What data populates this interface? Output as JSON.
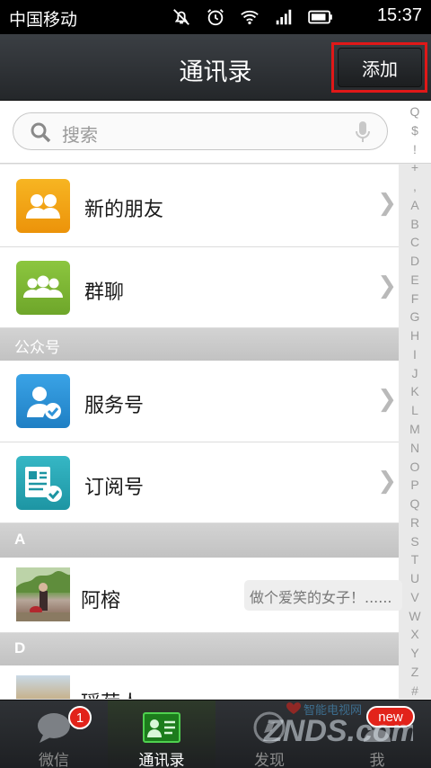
{
  "status_bar": {
    "carrier": "中国移动",
    "time": "15:37"
  },
  "header": {
    "title": "通讯录",
    "add_button": "添加"
  },
  "search": {
    "placeholder": "搜索"
  },
  "top_items": [
    {
      "label": "新的朋友",
      "icon": "new-friends-icon"
    },
    {
      "label": "群聊",
      "icon": "group-chat-icon"
    }
  ],
  "sections": {
    "official": "公众号",
    "a": "A",
    "d": "D"
  },
  "official_items": [
    {
      "label": "服务号",
      "icon": "service-account-icon"
    },
    {
      "label": "订阅号",
      "icon": "subscription-account-icon"
    }
  ],
  "contacts": [
    {
      "name": "阿榕",
      "signature": "做个爱笑的女子！......"
    },
    {
      "name": "瑶荷人"
    }
  ],
  "index": [
    "Q",
    "$",
    "!",
    "+",
    ",",
    "A",
    "B",
    "C",
    "D",
    "E",
    "F",
    "G",
    "H",
    "I",
    "J",
    "K",
    "L",
    "M",
    "N",
    "O",
    "P",
    "Q",
    "R",
    "S",
    "T",
    "U",
    "V",
    "W",
    "X",
    "Y",
    "Z",
    "#"
  ],
  "tabs": [
    {
      "label": "微信",
      "badge": "1"
    },
    {
      "label": "通讯录"
    },
    {
      "label": "发现"
    },
    {
      "label": "我",
      "badge": "new"
    }
  ],
  "watermark": {
    "text": "ZNDS.com",
    "tagline": "智能电视网"
  },
  "colors": {
    "accent_red": "#e01818",
    "badge_red": "#e2231a",
    "new_friends": "#f2a30f",
    "group_chat": "#7ab42e",
    "service": "#2f93d8",
    "subscription": "#2aa7b5"
  }
}
